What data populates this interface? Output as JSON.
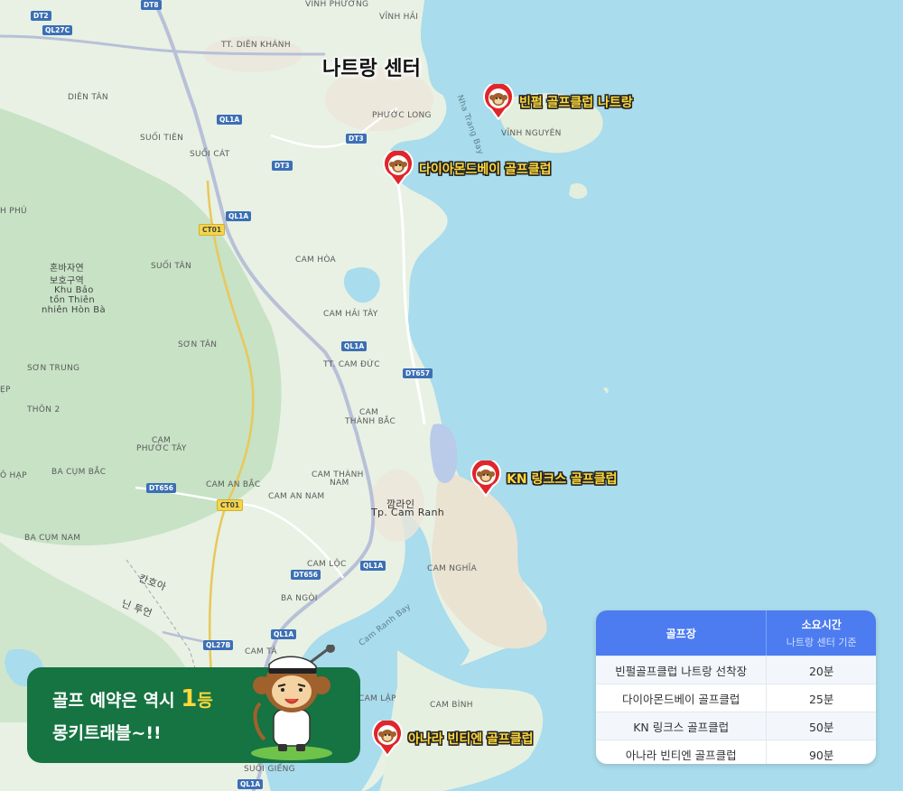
{
  "center_label": "나트랑 센터",
  "markers": [
    {
      "label": "빈펄 골프클럽 나트랑"
    },
    {
      "label": "다이아몬드베이 골프클럽"
    },
    {
      "label": "KN 링크스 골프클럽"
    },
    {
      "label": "아나라 빈티엔 골프클럽"
    }
  ],
  "places": {
    "vinh_phuong": "VĨNH PHƯƠNG",
    "vinh_hai": "VĨNH HẢI",
    "tt_dien_khanh": "TT. DIÊN KHÁNH",
    "dien_tan": "DIÊN TÂN",
    "phuoc_long": "PHƯỚC LONG",
    "vinh_nguyen": "VĨNH NGUYÊN",
    "suoi_tien": "SUỐI TIÊN",
    "suoi_cat": "SUỐI CÁT",
    "hphu": "H PHÚ",
    "suoi_tan": "SUỐI TÂN",
    "cam_hoa": "CAM HÒA",
    "reserve_kr1": "혼바자연",
    "reserve_kr2": "보호구역",
    "reserve_vn1": "Khu Bảo",
    "reserve_vn2": "tồn Thiên",
    "reserve_vn3": "nhiên Hòn Bà",
    "cam_hai_tay": "CAM HẢI TÂY",
    "son_tan": "SƠN TÂN",
    "son_trung": "SƠN TRUNG",
    "tt_cam_duc": "TT. CAM ĐỨC",
    "thon2": "THÔN 2",
    "cam_thanh_bac1": "CAM",
    "cam_thanh_bac2": "THÀNH BẮC",
    "cam_phuoc_tay1": "CAM",
    "cam_phuoc_tay2": "PHƯỚC TÂY",
    "ba_cum_bac": "BA CỤM BẮC",
    "ohap": "Ô HẠP",
    "cam_an_bac": "CAM AN BẮC",
    "cam_thanh_nam1": "CAM THÀNH",
    "cam_thanh_nam2": "NAM",
    "cam_an_nam": "CAM AN NAM",
    "camranh_kr": "깜라인",
    "camranh_vn": "Tp. Cam Ranh",
    "ba_cum_nam": "BA CỤM NAM",
    "cam_loc": "CAM LỘC",
    "cam_nghia": "CAM NGHĨA",
    "ba_ngoi": "BA NGÒI",
    "kr_road1": "칸호아",
    "kr_road2": "닌 투언",
    "cam_lap": "CAM LẬP",
    "cam_binh": "CAM BÌNH",
    "suoi_gieng": "SUỐI GIẾNG",
    "cam_ta": "CAM TÂ",
    "nha_trang_bay": "Nha Trang Bay",
    "cam_ranh_bay": "Cam Ranh Bay",
    "ep": "ẸP"
  },
  "shields": {
    "dt2": "DT2",
    "dt8": "DT8",
    "ql27c": "QL27C",
    "ql1a_1": "QL1A",
    "dt3_1": "DT3",
    "dt3_2": "DT3",
    "ql1a_2": "QL1A",
    "ct01_1": "CT01",
    "ql1a_3": "QL1A",
    "dt657": "DT657",
    "dt656_1": "DT656",
    "ct01_2": "CT01",
    "ql1a_4": "QL1A",
    "dt656_2": "DT656",
    "ql1a_5": "QL1A",
    "ql27b": "QL27B",
    "ql1a_6": "QL1A"
  },
  "banner": {
    "line1_a": "골프 예약은 역시 ",
    "line1_b": "1",
    "line1_c": "등",
    "line2": "몽키트래블~!!"
  },
  "table": {
    "col1": "골프장",
    "col2_title": "소요시간",
    "col2_sub": "나트랑 센터 기준",
    "rows": [
      {
        "name": "빈펄골프클럽 나트랑 선착장",
        "time": "20분"
      },
      {
        "name": "다이아몬드베이 골프클럽",
        "time": "25분"
      },
      {
        "name": "KN 링크스 골프클럽",
        "time": "50분"
      },
      {
        "name": "아나라 빈티엔 골프클럽",
        "time": "90분"
      }
    ]
  },
  "colors": {
    "sea": "#a9dcec",
    "land": "#e8f1e4",
    "forest": "#c7e2c5",
    "banner": "#167342",
    "table_header": "#4c7cf0",
    "accent": "#ffd83a"
  }
}
